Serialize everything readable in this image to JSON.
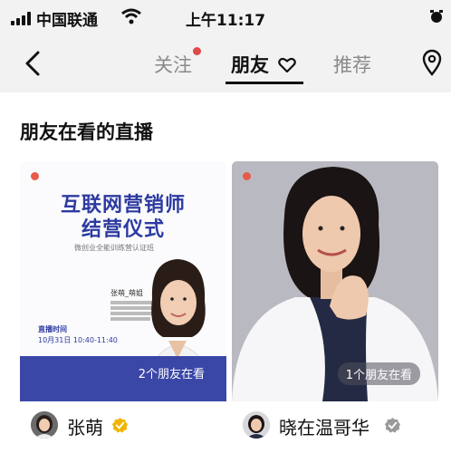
{
  "status_bar": {
    "carrier": "中国联通",
    "time": "上午11:17"
  },
  "nav": {
    "tabs": [
      {
        "label": "关注",
        "has_dot": true
      },
      {
        "label": "朋友",
        "active": true
      },
      {
        "label": "推荐"
      }
    ]
  },
  "section": {
    "title": "朋友在看的直播"
  },
  "cards": [
    {
      "poster_title_line1": "互联网营销师",
      "poster_title_line2": "结营仪式",
      "poster_subtitle": "微创业全能训练营认证班",
      "poster_host": "张萌_萌姐",
      "poster_time_label": "直播时间",
      "poster_time": "10月31日 10:40-11:40",
      "friends_watching": "2个朋友在看",
      "host_name": "张萌",
      "badge": "gold-verified-icon"
    },
    {
      "friends_watching": "1个朋友在看",
      "host_name": "晓在温哥华",
      "badge": "gray-verified-icon"
    }
  ],
  "colors": {
    "live_dot": "#e85a4a",
    "poster_blue": "#3b47a7",
    "gold_badge": "#f0b400",
    "gray_badge": "#9a9a9a"
  }
}
